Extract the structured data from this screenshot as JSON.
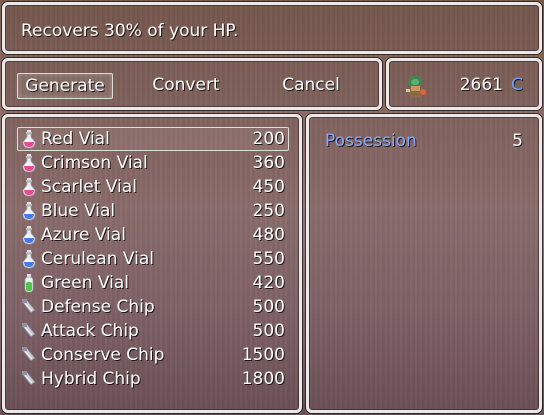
{
  "help": {
    "text": "Recovers 30% of your HP."
  },
  "commands": {
    "generate": "Generate",
    "convert": "Convert",
    "cancel": "Cancel"
  },
  "currency": {
    "amount": "2661",
    "unit": "C",
    "icon": "alchemist-icon"
  },
  "items": [
    {
      "name": "Red Vial",
      "price": "200",
      "icon": "red-potion-icon",
      "color": "#e84a8a"
    },
    {
      "name": "Crimson Vial",
      "price": "360",
      "icon": "crimson-potion-icon",
      "color": "#e84a8a"
    },
    {
      "name": "Scarlet Vial",
      "price": "450",
      "icon": "scarlet-potion-icon",
      "color": "#e84a8a"
    },
    {
      "name": "Blue Vial",
      "price": "250",
      "icon": "blue-potion-icon",
      "color": "#4a7ae8"
    },
    {
      "name": "Azure Vial",
      "price": "480",
      "icon": "azure-potion-icon",
      "color": "#4a7ae8"
    },
    {
      "name": "Cerulean Vial",
      "price": "550",
      "icon": "cerulean-potion-icon",
      "color": "#4a7ae8"
    },
    {
      "name": "Green Vial",
      "price": "420",
      "icon": "green-potion-icon",
      "color": "#4ac84a"
    },
    {
      "name": "Defense Chip",
      "price": "500",
      "icon": "chip-icon",
      "color": "#c8c8d0"
    },
    {
      "name": "Attack Chip",
      "price": "500",
      "icon": "chip-icon",
      "color": "#c8c8d0"
    },
    {
      "name": "Conserve Chip",
      "price": "1500",
      "icon": "chip-icon",
      "color": "#c8c8d0"
    },
    {
      "name": "Hybrid Chip",
      "price": "1800",
      "icon": "chip-icon",
      "color": "#c8c8d0"
    }
  ],
  "selected_index": 0,
  "possession": {
    "label": "Possession",
    "value": "5"
  }
}
